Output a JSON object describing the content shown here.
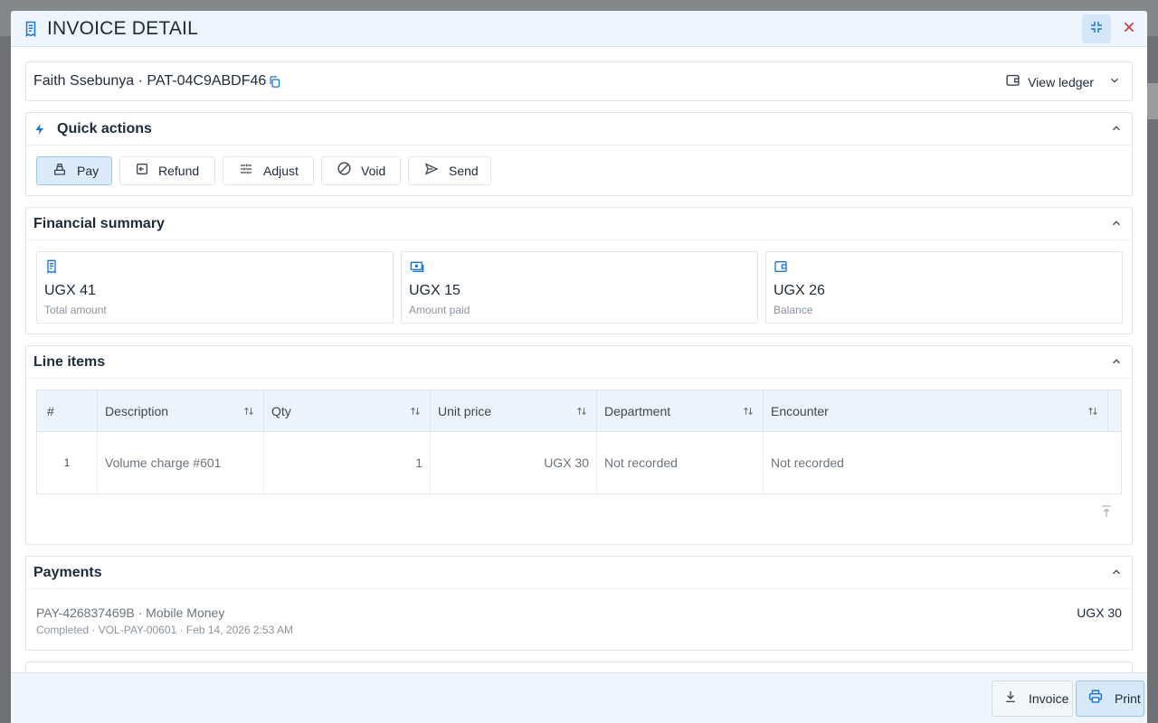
{
  "colors": {
    "accent": "#1976d2",
    "close": "#d32f2f",
    "header_bg": "#eef5fc"
  },
  "modal": {
    "title": "INVOICE DETAIL",
    "icon": "receipt-icon",
    "collapse_icon": "collapse-icon",
    "close_icon": "close-icon"
  },
  "patient": {
    "label": "Faith Ssebunya · PAT-04C9ABDF46",
    "copy_icon": "copy-icon",
    "view_ledger": "View ledger"
  },
  "quick_actions": {
    "title": "Quick actions",
    "buttons": [
      {
        "label": "Pay",
        "icon": "cash-register-icon"
      },
      {
        "label": "Refund",
        "icon": "refund-icon"
      },
      {
        "label": "Adjust",
        "icon": "sliders-icon"
      },
      {
        "label": "Void",
        "icon": "block-icon"
      },
      {
        "label": "Send",
        "icon": "send-icon"
      }
    ]
  },
  "financial_summary": {
    "title": "Financial summary",
    "tiles": [
      {
        "amount": "UGX 41",
        "caption": "Total amount",
        "icon": "receipt-icon"
      },
      {
        "amount": "UGX 15",
        "caption": "Amount paid",
        "icon": "payments-icon"
      },
      {
        "amount": "UGX 26",
        "caption": "Balance",
        "icon": "wallet-icon"
      }
    ]
  },
  "line_items": {
    "title": "Line items",
    "columns": [
      "#",
      "Description",
      "Qty",
      "Unit price",
      "Department",
      "Encounter"
    ],
    "rows": [
      [
        "1",
        "Volume charge #601",
        "1",
        "UGX 30",
        "Not recorded",
        "Not recorded"
      ]
    ]
  },
  "payments": {
    "title": "Payments",
    "items": [
      {
        "line1": "PAY-426837469B · Mobile Money",
        "line2": "Completed · VOL-PAY-00601 · Feb 14, 2026 2:53 AM",
        "amount": "UGX 30"
      }
    ]
  },
  "footer": {
    "invoice_label": "Invoice",
    "print_label": "Print"
  }
}
